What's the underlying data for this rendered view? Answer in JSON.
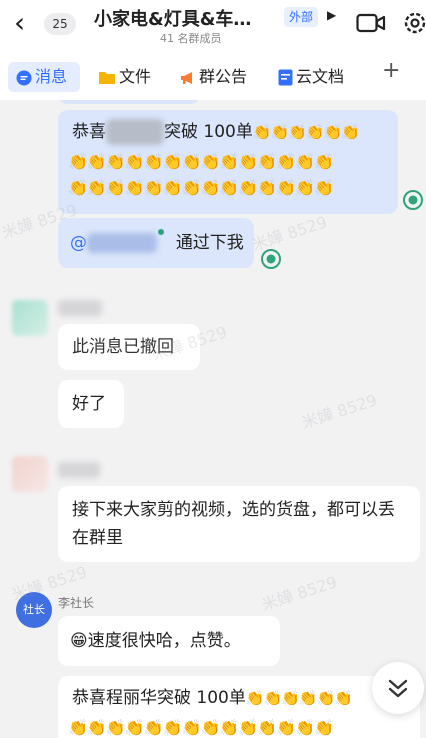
{
  "header": {
    "unread_count": "25",
    "title": "小家电&灯具&车…",
    "member_count": "41 名群成员",
    "external_tag": "外部"
  },
  "tabs": [
    {
      "label": "消息",
      "icon": "chat-icon"
    },
    {
      "label": "文件",
      "icon": "folder-icon"
    },
    {
      "label": "群公告",
      "icon": "megaphone-icon"
    },
    {
      "label": "云文档",
      "icon": "doc-icon"
    }
  ],
  "messages": {
    "m1_prefix": "恭喜",
    "m1_suffix": "突破 100单",
    "m2_prefix": "@",
    "m2_suffix": "通过下我",
    "m3": "此消息已撤回",
    "m4": "好了",
    "m5": "接下来大家剪的视频，选的货盘，都可以丢在群里",
    "sender_name": "李社长",
    "sender_avatar": "社长",
    "m6_emoji": "😁",
    "m6": "速度很快哈，点赞。",
    "m7": "恭喜程丽华突破 100单"
  },
  "watermark": "米嬅 8529",
  "colors": {
    "accent": "#3370ff",
    "self_bubble": "#dbe6fc",
    "read_check": "#2fa37a",
    "avatar_blue": "#3f6fe0"
  }
}
